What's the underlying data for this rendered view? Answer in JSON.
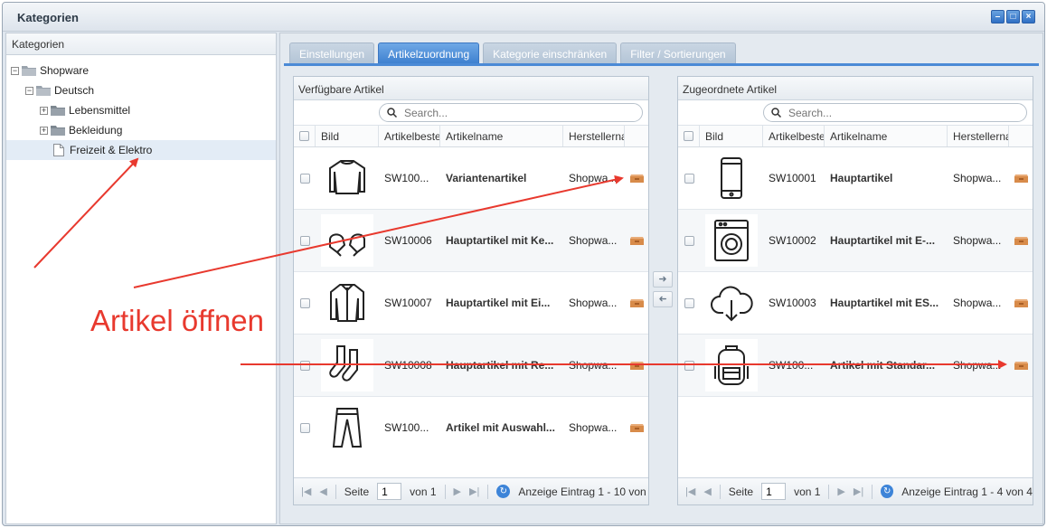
{
  "window": {
    "title": "Kategorien"
  },
  "tree": {
    "header": "Kategorien",
    "nodes": [
      {
        "label": "Shopware",
        "toggle": "−"
      },
      {
        "label": "Deutsch",
        "toggle": "−"
      },
      {
        "label": "Lebensmittel",
        "toggle": "+"
      },
      {
        "label": "Bekleidung",
        "toggle": "+"
      },
      {
        "label": "Freizeit & Elektro"
      }
    ]
  },
  "tabs": [
    {
      "label": "Einstellungen"
    },
    {
      "label": "Artikelzuordnung"
    },
    {
      "label": "Kategorie einschränken"
    },
    {
      "label": "Filter / Sortierungen"
    }
  ],
  "left_panel": {
    "title": "Verfügbare Artikel",
    "search_placeholder": "Search...",
    "columns": {
      "img": "Bild",
      "num": "Artikelbeste",
      "name": "Artikelname",
      "man": "Herstellerna"
    },
    "rows": [
      {
        "number": "SW100...",
        "name": "Variantenartikel",
        "manufacturer": "Shopwa...",
        "icon": "sweater-icon"
      },
      {
        "number": "SW10006",
        "name": "Hauptartikel mit Ke...",
        "manufacturer": "Shopwa...",
        "icon": "gloves-icon"
      },
      {
        "number": "SW10007",
        "name": "Hauptartikel mit Ei...",
        "manufacturer": "Shopwa...",
        "icon": "jacket-icon"
      },
      {
        "number": "SW10008",
        "name": "Hauptartikel mit Re...",
        "manufacturer": "Shopwa...",
        "icon": "socks-icon"
      },
      {
        "number": "SW100...",
        "name": "Artikel mit Auswahl...",
        "manufacturer": "Shopwa...",
        "icon": "trousers-icon"
      }
    ],
    "pager": {
      "page_label": "Seite",
      "page": "1",
      "of_label": "von 1",
      "display": "Anzeige Eintrag 1 - 10 von"
    }
  },
  "right_panel": {
    "title": "Zugeordnete Artikel",
    "search_placeholder": "Search...",
    "columns": {
      "img": "Bild",
      "num": "Artikelbeste",
      "name": "Artikelname",
      "man": "Herstellerna"
    },
    "rows": [
      {
        "number": "SW10001",
        "name": "Hauptartikel",
        "manufacturer": "Shopwa...",
        "icon": "smartphone-icon"
      },
      {
        "number": "SW10002",
        "name": "Hauptartikel mit E-...",
        "manufacturer": "Shopwa...",
        "icon": "washing-machine-icon"
      },
      {
        "number": "SW10003",
        "name": "Hauptartikel mit ES...",
        "manufacturer": "Shopwa...",
        "icon": "cloud-download-icon"
      },
      {
        "number": "SW100...",
        "name": "Artikel mit Standar...",
        "manufacturer": "Shopwa...",
        "icon": "backpack-icon"
      }
    ],
    "pager": {
      "page_label": "Seite",
      "page": "1",
      "of_label": "von 1",
      "display": "Anzeige Eintrag 1 - 4 von 4"
    }
  },
  "annotation": {
    "text": "Artikel öffnen",
    "color": "#e8392e"
  },
  "colors": {
    "tab_active": "#3c7fcf",
    "tab_inactive": "#b3c4d6",
    "selection": "#e3ecf6"
  }
}
